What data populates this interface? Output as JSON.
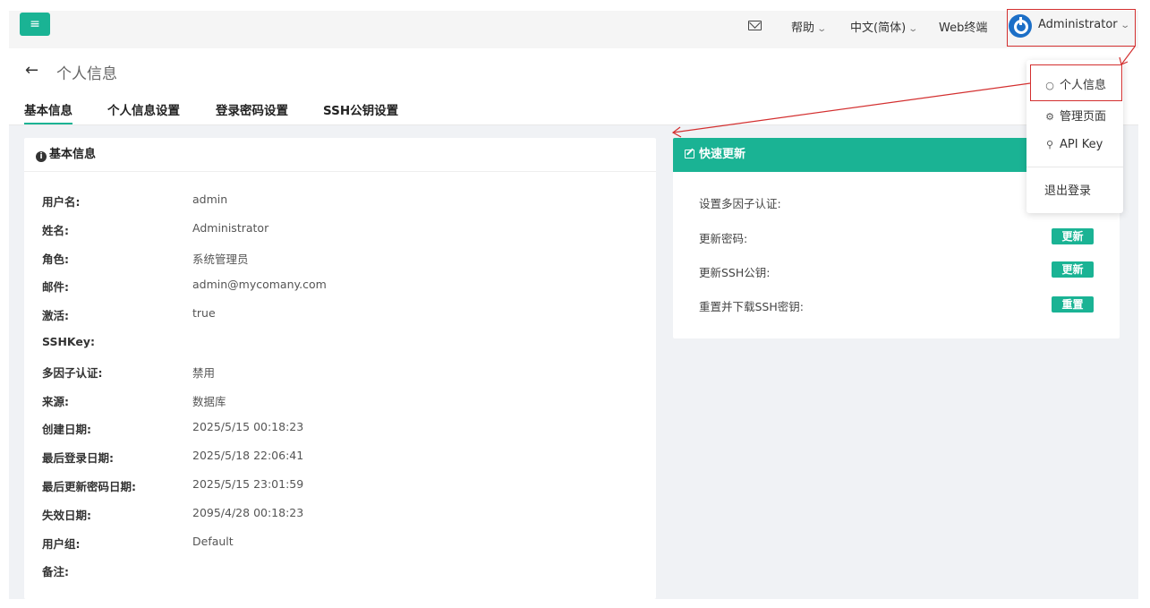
{
  "header": {
    "menu_icon": "hamburger-icon",
    "help_label": "帮助",
    "language_label": "中文(简体)",
    "webterm_label": "Web终端",
    "user_label": "Administrator",
    "mail_icon": "mail-icon",
    "logo_icon": "power-logo-icon"
  },
  "page": {
    "title": "个人信息",
    "tabs": [
      {
        "label": "基本信息"
      },
      {
        "label": "个人信息设置"
      },
      {
        "label": "登录密码设置"
      },
      {
        "label": "SSH公钥设置"
      }
    ]
  },
  "basic_info": {
    "title": "基本信息",
    "rows": [
      {
        "key": "用户名:",
        "value": "admin"
      },
      {
        "key": "姓名:",
        "value": "Administrator"
      },
      {
        "key": "角色:",
        "value": "系统管理员"
      },
      {
        "key": "邮件:",
        "value": "admin@mycomany.com"
      },
      {
        "key": "激活:",
        "value": "true"
      },
      {
        "key": "SSHKey:",
        "value": ""
      },
      {
        "key": "多因子认证:",
        "value": "禁用"
      },
      {
        "key": "来源:",
        "value": "数据库"
      },
      {
        "key": "创建日期:",
        "value": "2025/5/15 00:18:23"
      },
      {
        "key": "最后登录日期:",
        "value": "2025/5/18 22:06:41"
      },
      {
        "key": "最后更新密码日期:",
        "value": "2025/5/15 23:01:59"
      },
      {
        "key": "失效日期:",
        "value": "2095/4/28 00:18:23"
      },
      {
        "key": "用户组:",
        "value": "Default"
      },
      {
        "key": "备注:",
        "value": ""
      }
    ]
  },
  "quick_update": {
    "title": "快速更新",
    "rows": [
      {
        "label": "设置多因子认证:",
        "button": ""
      },
      {
        "label": "更新密码:",
        "button": "更新"
      },
      {
        "label": "更新SSH公钥:",
        "button": "更新"
      },
      {
        "label": "重置并下载SSH密钥:",
        "button": "重置"
      }
    ]
  },
  "user_menu": {
    "items": [
      {
        "label": "个人信息",
        "icon": "user-icon"
      },
      {
        "label": "管理页面",
        "icon": "admin-icon"
      },
      {
        "label": "API Key",
        "icon": "key-icon"
      },
      {
        "label": "退出登录",
        "icon": ""
      }
    ]
  },
  "colors": {
    "accent": "#1ab394",
    "annotation": "#d32f2f",
    "logo": "#1c6fc7"
  }
}
